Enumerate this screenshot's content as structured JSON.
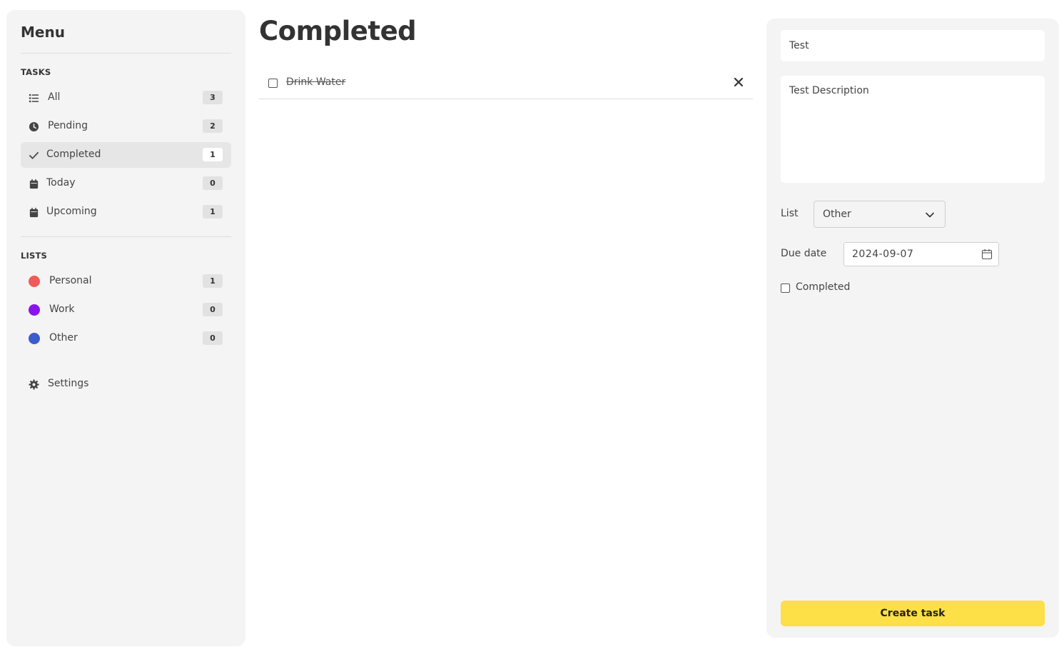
{
  "sidebar": {
    "title": "Menu",
    "tasks_heading": "TASKS",
    "tasks": [
      {
        "label": "All",
        "count": "3",
        "icon": "list-icon"
      },
      {
        "label": "Pending",
        "count": "2",
        "icon": "clock-icon"
      },
      {
        "label": "Completed",
        "count": "1",
        "icon": "check-icon",
        "active": true
      },
      {
        "label": "Today",
        "count": "0",
        "icon": "calendar-icon"
      },
      {
        "label": "Upcoming",
        "count": "1",
        "icon": "calendar-icon"
      }
    ],
    "lists_heading": "LISTS",
    "lists": [
      {
        "label": "Personal",
        "count": "1",
        "color": "#ef5a5a"
      },
      {
        "label": "Work",
        "count": "0",
        "color": "#8a14ee"
      },
      {
        "label": "Other",
        "count": "0",
        "color": "#3c5ccc"
      }
    ],
    "settings_label": "Settings"
  },
  "main": {
    "title": "Completed",
    "tasks": [
      {
        "label": "Drink Water",
        "checked": false
      }
    ]
  },
  "panel": {
    "title_value": "Test",
    "description_value": "Test Description",
    "list_label": "List",
    "list_selected": "Other",
    "due_label": "Due date",
    "due_value": "2024-09-07",
    "completed_label": "Completed",
    "create_label": "Create task",
    "accent_color": "#fddf47"
  }
}
